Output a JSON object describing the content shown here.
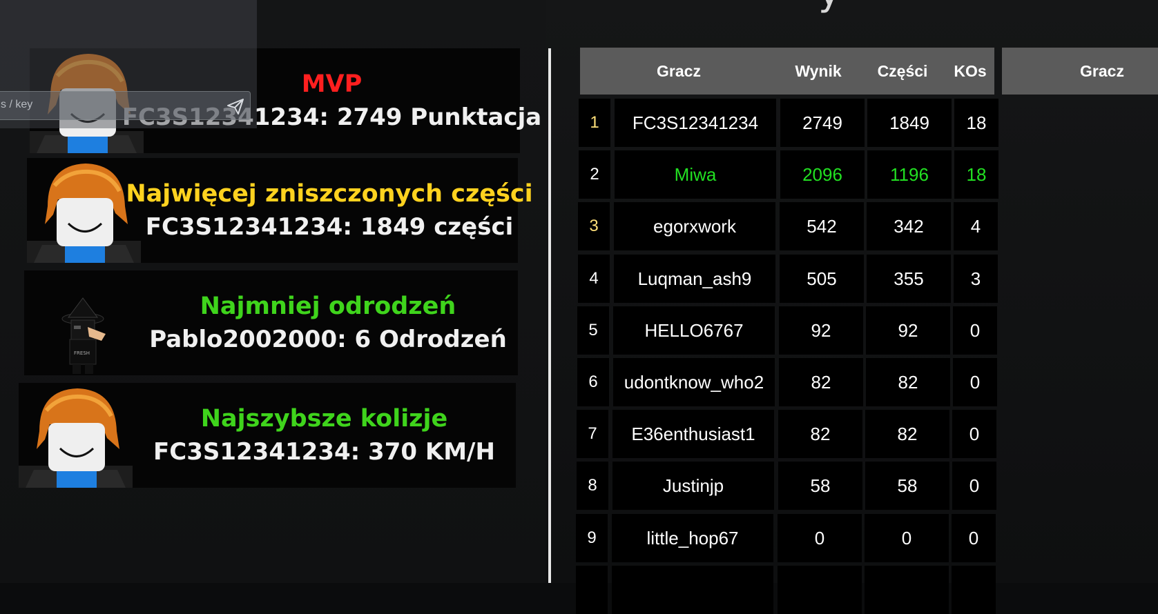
{
  "chat": {
    "placeholder": "s / key"
  },
  "awards": [
    {
      "title": "MVP",
      "title_color": "#ff1f1f",
      "value": "FC3S12341234: 2749 Punktacja",
      "avatar": "noob-avatar"
    },
    {
      "title": "Najwięcej zniszczonych części",
      "title_color": "#ffd21f",
      "value": "FC3S12341234: 1849 części",
      "avatar": "noob-avatar"
    },
    {
      "title": "Najmniej odrodzeń",
      "title_color": "#3fd41c",
      "value": "Pablo2002000: 6 Odrodzeń",
      "avatar": "black-hat-avatar"
    },
    {
      "title": "Najszybsze kolizje",
      "title_color": "#3fd41c",
      "value": "FC3S12341234: 370 KM/H",
      "avatar": "noob-avatar"
    }
  ],
  "leaderboard": {
    "headers": {
      "player": "Gracz",
      "score": "Wynik",
      "parts": "Części",
      "kos": "KOs"
    },
    "second_table_header": "Gracz",
    "rows": [
      {
        "rank": "1",
        "player": "FC3S12341234",
        "score": "2749",
        "parts": "1849",
        "kos": "18",
        "rank_color": "#ffe07a",
        "color": "#ffffff"
      },
      {
        "rank": "2",
        "player": "Miwa",
        "score": "2096",
        "parts": "1196",
        "kos": "18",
        "rank_color": "#ffffff",
        "color": "#22e022"
      },
      {
        "rank": "3",
        "player": "egorxwork",
        "score": "542",
        "parts": "342",
        "kos": "4",
        "rank_color": "#ffe07a",
        "color": "#ffffff"
      },
      {
        "rank": "4",
        "player": "Luqman_ash9",
        "score": "505",
        "parts": "355",
        "kos": "3",
        "rank_color": "#ffffff",
        "color": "#ffffff"
      },
      {
        "rank": "5",
        "player": "HELLO6767",
        "score": "92",
        "parts": "92",
        "kos": "0",
        "rank_color": "#ffffff",
        "color": "#ffffff"
      },
      {
        "rank": "6",
        "player": "udontknow_who2",
        "score": "82",
        "parts": "82",
        "kos": "0",
        "rank_color": "#ffffff",
        "color": "#ffffff"
      },
      {
        "rank": "7",
        "player": "E36enthusiast1",
        "score": "82",
        "parts": "82",
        "kos": "0",
        "rank_color": "#ffffff",
        "color": "#ffffff"
      },
      {
        "rank": "8",
        "player": "Justinjp",
        "score": "58",
        "parts": "58",
        "kos": "0",
        "rank_color": "#ffffff",
        "color": "#ffffff"
      },
      {
        "rank": "9",
        "player": "little_hop67",
        "score": "0",
        "parts": "0",
        "kos": "0",
        "rank_color": "#ffffff",
        "color": "#ffffff"
      }
    ]
  }
}
